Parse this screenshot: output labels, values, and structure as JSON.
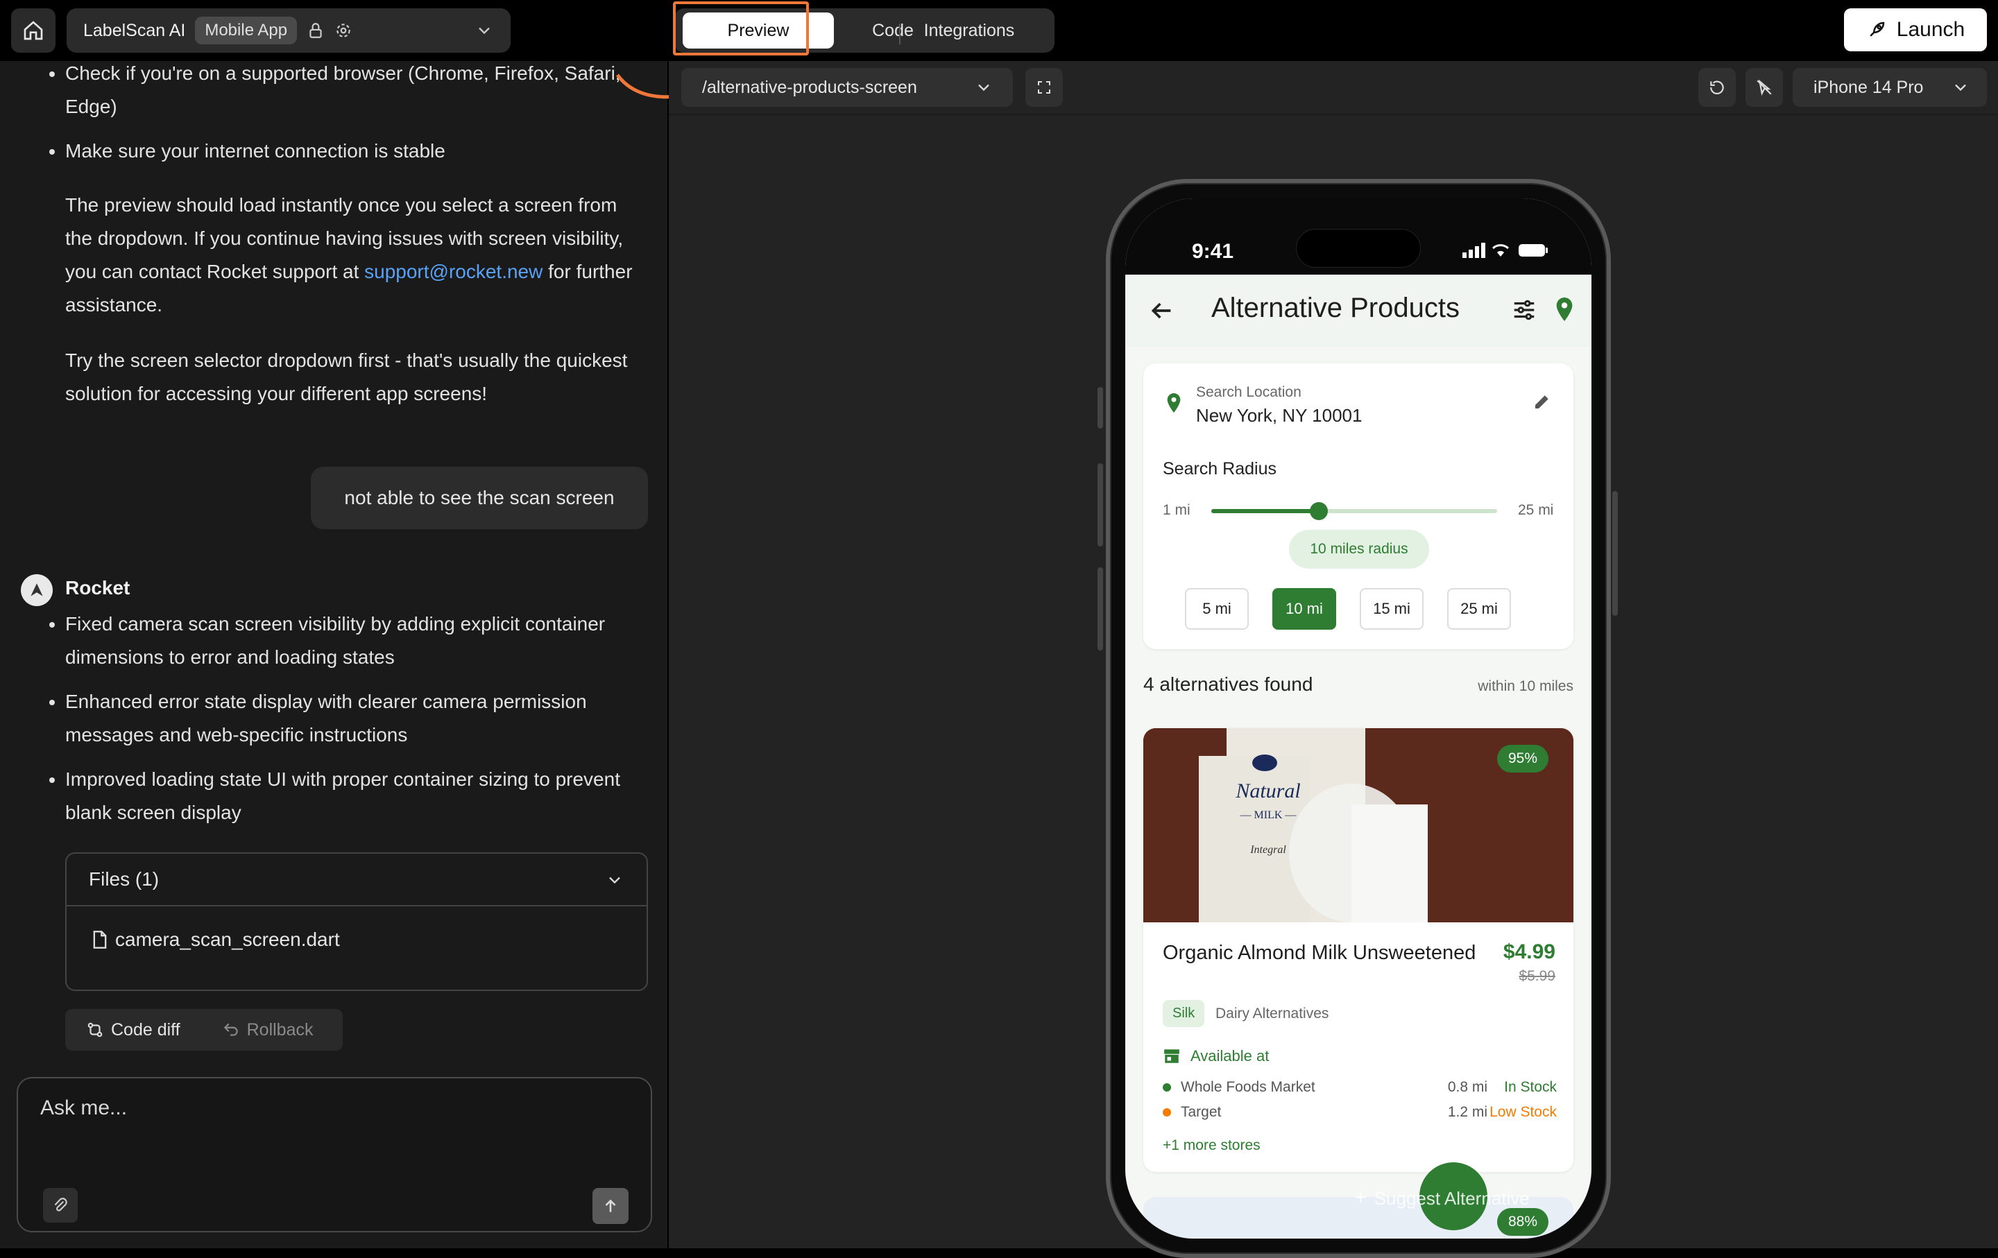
{
  "topbar": {
    "project_name": "LabelScan AI",
    "project_badge": "Mobile App",
    "tabs": {
      "preview": "Preview",
      "code": "Code",
      "integrations": "Integrations"
    },
    "launch_label": "Launch"
  },
  "chat": {
    "bullets_top": [
      "Check if you're on a supported browser (Chrome, Firefox, Safari, Edge)",
      "Make sure your internet connection is stable"
    ],
    "para1_before": "The preview should load instantly once you select a screen from the dropdown. If you continue having issues with screen visibility, you can contact Rocket support at ",
    "para1_link": "support@rocket.new",
    "para1_after": " for further assistance.",
    "para2": "Try the screen selector dropdown first - that's usually the quickest solution for accessing your different app screens!",
    "user_message": "not able to see the scan screen",
    "assistant_name": "Rocket",
    "assistant_bullets": [
      "Fixed camera scan screen visibility by adding explicit container dimensions to error and loading states",
      "Enhanced error state display with clearer camera permission messages and web-specific instructions",
      "Improved loading state UI with proper container sizing to prevent blank screen display"
    ],
    "files_header": "Files (1)",
    "file_name": "camera_scan_screen.dart",
    "code_diff_label": "Code diff",
    "rollback_label": "Rollback",
    "ask_placeholder": "Ask me..."
  },
  "preview": {
    "route": "/alternative-products-screen",
    "device": "iPhone 14 Pro"
  },
  "app": {
    "status_time": "9:41",
    "title": "Alternative Products",
    "search_location_label": "Search Location",
    "search_location_value": "New York, NY 10001",
    "search_radius_label": "Search Radius",
    "slider_min": "1 mi",
    "slider_max": "25 mi",
    "slider_value": 10,
    "slider_range": [
      1,
      25
    ],
    "radius_chip": "10 miles radius",
    "radius_options": [
      "5 mi",
      "10 mi",
      "15 mi",
      "25 mi"
    ],
    "radius_selected_index": 1,
    "found_title": "4 alternatives found",
    "found_within": "within 10 miles",
    "product": {
      "match": "95%",
      "name": "Organic Almond Milk Unsweetened",
      "price": "$4.99",
      "old_price": "$5.99",
      "brand": "Silk",
      "category": "Dairy Alternatives",
      "available_label": "Available at",
      "stores": [
        {
          "name": "Whole Foods Market",
          "distance": "0.8 mi",
          "stock": "In Stock",
          "color": "#2e7d32"
        },
        {
          "name": "Target",
          "distance": "1.2 mi",
          "stock": "Low Stock",
          "color": "#f57c00"
        }
      ],
      "more_stores": "+1 more stores"
    },
    "second_match": "88%",
    "fab_label": "Suggest Alternative"
  },
  "colors": {
    "accent_green": "#2e7d32",
    "highlight_orange": "#f0773a",
    "link_blue": "#5aa2f5"
  }
}
